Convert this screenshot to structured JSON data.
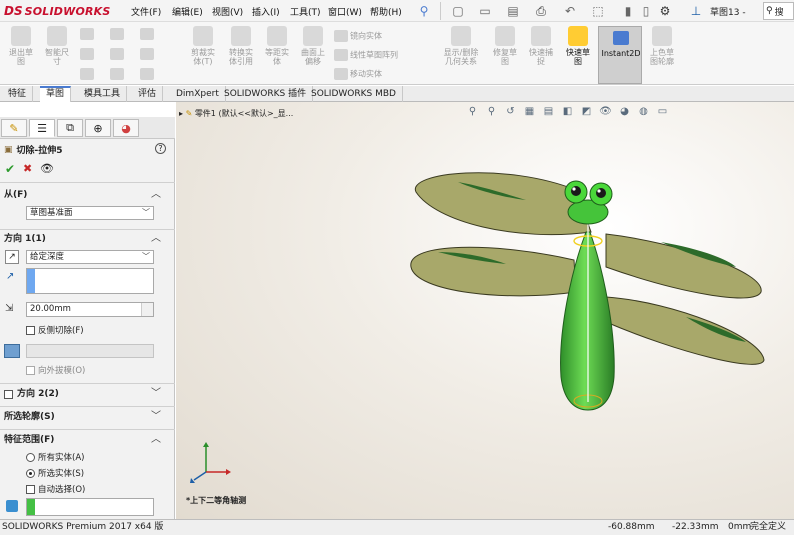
{
  "app": {
    "logo_mark": "DS",
    "logo_text": "SOLIDWORKS"
  },
  "menu": [
    "文件(F)",
    "编辑(E)",
    "视图(V)",
    "插入(I)",
    "工具(T)",
    "窗口(W)",
    "帮助(H)"
  ],
  "doc_title": "草图13 -",
  "search": {
    "placeholder": "搜"
  },
  "commands": {
    "exit_sketch": "退出草\n图",
    "smart_dim": "智能尺\n寸",
    "trim_entities": "剪裁实\n体(T)",
    "convert_entities": "转换实\n体引用",
    "offset_entities": "等距实\n体",
    "surface_offset": "曲面上\n偏移",
    "mirror_entities": "镜向实体",
    "linear_pattern": "线性草图阵列",
    "move_entities": "移动实体",
    "display_relations": "显示/删除\n几何关系",
    "repair_sketch": "修复草\n图",
    "quick_snaps": "快速捕\n捉",
    "rapid_sketch": "快速草\n图",
    "instant2d": "Instant2D",
    "shaded_sketch": "上色草\n图轮廓"
  },
  "tabs": [
    "特征",
    "草图",
    "模具工具",
    "评估",
    "DimXpert",
    "SOLIDWORKS 插件",
    "SOLIDWORKS MBD"
  ],
  "active_tab": "草图",
  "feature_tree": {
    "part_label": "零件1  (默认<<默认>_显..."
  },
  "property_manager": {
    "title": "切除-拉伸5",
    "from": {
      "label": "从(F)",
      "value": "草图基准面"
    },
    "direction1": {
      "label": "方向 1(1)",
      "end_condition": "给定深度",
      "depth": "20.00mm",
      "flip_side": "反侧切除(F)",
      "draft_outward": "向外拔模(O)"
    },
    "direction2": {
      "label": "方向 2(2)"
    },
    "selected_contours": {
      "label": "所选轮廓(S)"
    },
    "feature_scope": {
      "label": "特征范围(F)",
      "all_bodies": "所有实体(A)",
      "selected_bodies": "所选实体(S)",
      "auto_select": "自动选择(O)",
      "selected": "selected_bodies"
    }
  },
  "viewport": {
    "view_name": "*上下二等角轴测"
  },
  "status_bar": {
    "product": "SOLIDWORKS Premium 2017 x64 版",
    "x": "-60.88mm",
    "y": "-22.33mm",
    "z": "0mm",
    "state": "完全定义"
  },
  "colors": {
    "accent": "#4a7bd0",
    "brand": "#c8102e",
    "model_green": "#4fb83c",
    "wing": "#a9a86a"
  }
}
